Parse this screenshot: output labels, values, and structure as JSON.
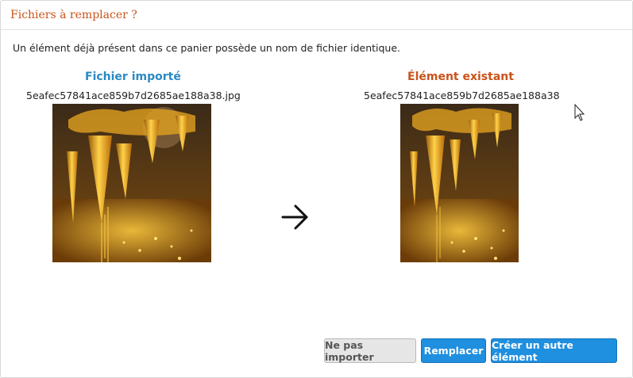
{
  "dialog": {
    "title": "Fichiers à remplacer ?",
    "message": "Un élément déjà présent dans ce panier possède un nom de fichier identique."
  },
  "imported": {
    "heading": "Fichier importé",
    "filename": "5eafec57841ace859b7d2685ae188a38.jpg",
    "image": "golden-ornaments-photo"
  },
  "existing": {
    "heading": "Élément existant",
    "filename": "5eafec57841ace859b7d2685ae188a38",
    "image": "golden-ornaments-photo"
  },
  "icons": {
    "arrow": "arrow-right-icon",
    "cursor": "mouse-pointer-icon"
  },
  "buttons": {
    "skip": "Ne pas importer",
    "replace": "Remplacer",
    "create": "Créer un autre élément"
  },
  "colors": {
    "title": "#c9531a",
    "imported_heading": "#2a8ac4",
    "existing_heading": "#c9531a",
    "primary_button": "#1f8fdf",
    "secondary_button": "#e6e6e6"
  }
}
